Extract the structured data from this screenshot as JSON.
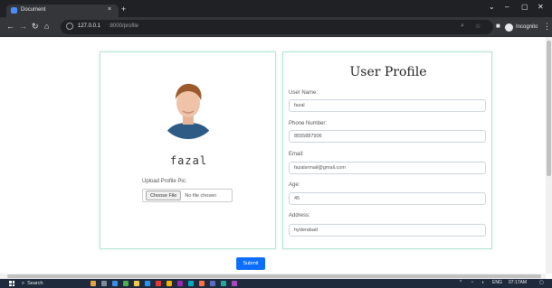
{
  "browser": {
    "tab_title": "Document",
    "tab_close": "×",
    "new_tab": "+",
    "url_host": "127.0.0.1",
    "url_path": ":8000/profile",
    "incognito_label": "Incognito",
    "controls": {
      "minimize": "⌄",
      "restore": "–",
      "maximize": "▢",
      "close": "✕"
    },
    "icons": [
      "back-icon",
      "forward-icon",
      "reload-icon",
      "home-icon",
      "info-icon",
      "zoom-icon",
      "star-icon",
      "extension-icon",
      "incognito-icon",
      "menu-icon"
    ]
  },
  "profile_card": {
    "username": "fazal",
    "upload_label": "Upload Profile Pic:",
    "choose_file": "Choose File",
    "no_file": "No file chosen"
  },
  "form": {
    "title": "User Profile",
    "fields": [
      {
        "label": "User Name:",
        "value": "fazal"
      },
      {
        "label": "Phone Number:",
        "value": "8555887906"
      },
      {
        "label": "Email:",
        "value": "fazalsrmail@gmail.com"
      },
      {
        "label": "Age:",
        "value": "45"
      },
      {
        "label": "Address:",
        "value": "hyderabad"
      }
    ]
  },
  "submit_label": "Submit",
  "taskbar": {
    "search_label": "Search",
    "lang": "ENG",
    "time": "07:17AM"
  },
  "colors": {
    "primary": "#0d6efd",
    "card_border": "#b6e6d8",
    "chrome_dark": "#202124",
    "taskbar": "#1f2b3d"
  }
}
